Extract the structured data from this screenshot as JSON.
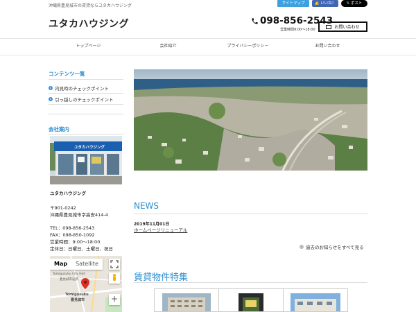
{
  "header": {
    "tagline": "沖縄県豊見城市の賃貸ならユタカハウジング",
    "sitemap": "サイトマップ",
    "like": "いいね！",
    "post": "ポスト",
    "logo": "ユタカハウジング",
    "phone": "098-856-2543",
    "hours": "営業時間9:00～18:00",
    "contact_btn": "お問い合わせ"
  },
  "nav": [
    "トップページ",
    "会社紹介",
    "プライバシーポリシー",
    "お問い合わせ"
  ],
  "sidebar": {
    "contents_heading": "コンテンツ一覧",
    "contents_links": [
      "内見時のチェックポイント",
      "引っ越しのチェックポイント"
    ],
    "company_heading": "会社案内",
    "company_name": "ユタカハウジング",
    "postal": "〒901-0242",
    "address": "沖縄県豊見城市字高安414-4",
    "tel": "TEL：098-856-2543",
    "fax": "FAX：098-850-1092",
    "hours": "営業時間：9:00～18:00",
    "holidays": "定休日：日曜日、土曜日、祝日",
    "store_sign": "ユタカハウジング"
  },
  "map": {
    "tab_map": "Map",
    "tab_satellite": "Satellite",
    "label_city_hall_en": "Tomigusuku City Hall",
    "label_city_hall_jp": "豊見城市役所",
    "label_city_en": "Tomigusuku",
    "label_city_jp": "豊見城市",
    "zoom_in": "+"
  },
  "news": {
    "heading": "NEWS",
    "date": "2019年11月01日",
    "title": "ホームページリニューアル",
    "see_all": "過去のお知らせをすべて見る"
  },
  "feature": {
    "heading": "賃貸物件特集"
  },
  "colors": {
    "accent": "#2a8ed1",
    "sitemap": "#3fa0e0",
    "facebook": "#4267b2",
    "x": "#000000"
  }
}
